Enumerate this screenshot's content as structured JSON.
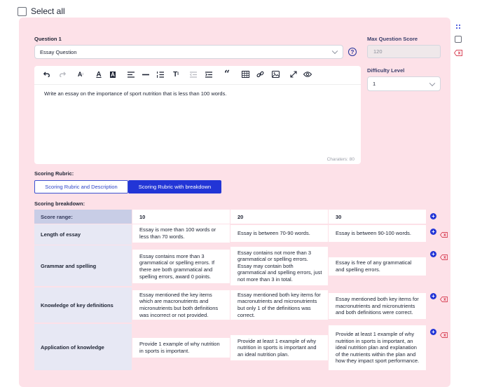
{
  "select_all": {
    "label": "Select all"
  },
  "question": {
    "label": "Question 1",
    "type_value": "Essay Question",
    "max_score_label": "Max Question Score",
    "max_score_placeholder": "120",
    "difficulty_label": "Difficulty Level",
    "difficulty_value": "1"
  },
  "editor": {
    "text": "Write an essay on the importance of sport nutrition that is less than 100 words.",
    "char_count": "Charaters: 80"
  },
  "rubric": {
    "label": "Scoring Rubric:",
    "tabs": [
      "Scoring Rubric and Description",
      "Scoring Rubric with breakdown"
    ],
    "active_tab": 1,
    "breakdown_label": "Scoring breakdown:",
    "range_label": "Score range:",
    "columns": [
      "10",
      "20",
      "30"
    ],
    "rows": [
      {
        "name": "Length of essay",
        "cells": [
          "Essay is more than 100 words or less than 70 words.",
          "Essay is between 70-90 words.",
          "Essay is between 90-100 words."
        ]
      },
      {
        "name": "Grammar and spelling",
        "cells": [
          "Essay contains more than 3 grammatical or spelling errors. If there are both grammatical and spelling errors, award 0 points.",
          "Essay contains not more than 3 grammatical or spelling errors. Essay may contain both grammatical and spelling errors, just not more than 3 in total.",
          "Essay is free of any grammatical and spelling errors."
        ]
      },
      {
        "name": "Knowledge of key definitions",
        "cells": [
          "Essay mentioned the key items which are macronutrients and micronutrients but both definitions was incorrect or not provided.",
          "Essay mentioned both key items for macronutrients and micronutrients but only 1 of the definitions was correct.",
          "Essay mentioned both key items for macronutrients and micronutrients and both definitions were correct."
        ]
      },
      {
        "name": "Application of knowledge",
        "cells": [
          "Provide 1 example of why nutrition in sports is important.",
          "Provide at least 1 example of why nutrition in sports is important and an ideal nutrition plan.",
          "Provide at least 1 example of why nutrition in sports is important, an ideal nutrition plan and explanation of the nutrients within the plan and how they impact sport performance."
        ]
      }
    ]
  },
  "colors": {
    "accent": "#2235d6",
    "card_bg": "#fde1e8",
    "delete": "#d9475a"
  }
}
